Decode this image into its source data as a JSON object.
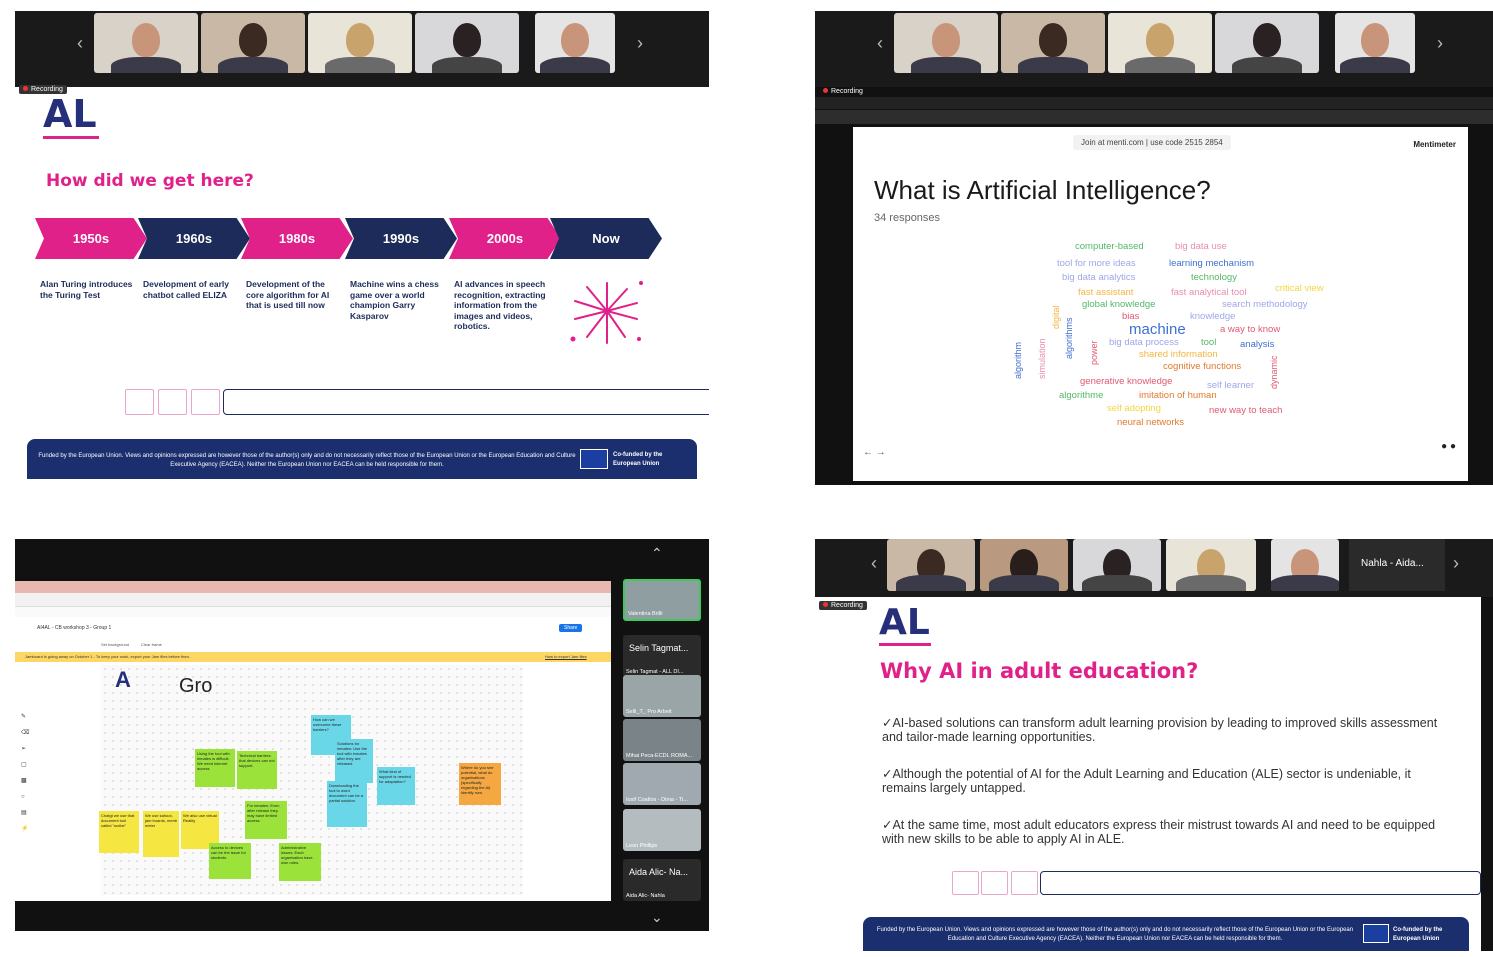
{
  "panel1": {
    "recording_label": "Recording",
    "logo_text": "AL",
    "title": "How did we get here?",
    "timeline": [
      {
        "label": "1950s",
        "color": "#e0218a",
        "desc": "Alan Turing introduces the Turing Test"
      },
      {
        "label": "1960s",
        "color": "#1c2b5a",
        "desc": "Development of early chatbot called ELIZA"
      },
      {
        "label": "1980s",
        "color": "#e0218a",
        "desc": "Development of the core algorithm for AI that is used till now"
      },
      {
        "label": "1990s",
        "color": "#1c2b5a",
        "desc": "Machine wins a chess game over a world champion Garry Kasparov"
      },
      {
        "label": "2000s",
        "color": "#e0218a",
        "desc": "AI advances in speech recognition, extracting information from the images and videos, robotics."
      },
      {
        "label": "Now",
        "color": "#1c2b5a",
        "desc": ""
      }
    ],
    "footer_text": "Funded by the European Union. Views and opinions expressed are however those of the author(s) only and do not necessarily reflect those of the European Union or the European Education and Culture Executive Agency (EACEA). Neither the European Union nor EACEA can be held responsible for them.",
    "cofunded": "Co-funded by the European Union"
  },
  "panel2": {
    "recording_label": "Recording",
    "join_text": "Join at menti.com | use code",
    "join_code": "2515 2854",
    "brand": "Mentimeter",
    "question": "What is Artificial Intelligence?",
    "responses": "34 responses",
    "words": [
      {
        "text": "computer-based",
        "color": "#52b86a"
      },
      {
        "text": "big data use",
        "color": "#e98fa8"
      },
      {
        "text": "tool for more ideas",
        "color": "#9fa6e8"
      },
      {
        "text": "learning mechanism",
        "color": "#3f6fd1"
      },
      {
        "text": "big data analytics",
        "color": "#9fa6e8"
      },
      {
        "text": "technology",
        "color": "#52b86a"
      },
      {
        "text": "fast assistant",
        "color": "#f2b642"
      },
      {
        "text": "fast analytical tool",
        "color": "#e98fa8"
      },
      {
        "text": "critical view",
        "color": "#f2d642"
      },
      {
        "text": "global knowledge",
        "color": "#52b86a"
      },
      {
        "text": "search methodology",
        "color": "#9fa6e8"
      },
      {
        "text": "bias",
        "color": "#e05a70"
      },
      {
        "text": "knowledge",
        "color": "#9fa6e8"
      },
      {
        "text": "machine",
        "color": "#3f6fd1"
      },
      {
        "text": "a way to know",
        "color": "#e05a70"
      },
      {
        "text": "big data process",
        "color": "#9fa6e8"
      },
      {
        "text": "tool",
        "color": "#52b86a"
      },
      {
        "text": "analysis",
        "color": "#3f6fd1"
      },
      {
        "text": "shared information",
        "color": "#f2b642"
      },
      {
        "text": "cognitive functions",
        "color": "#e07a30"
      },
      {
        "text": "generative knowledge",
        "color": "#e05a70"
      },
      {
        "text": "self learner",
        "color": "#9fa6e8"
      },
      {
        "text": "algorithme",
        "color": "#52b86a"
      },
      {
        "text": "imitation of human",
        "color": "#e07a30"
      },
      {
        "text": "self adopting",
        "color": "#f2d642"
      },
      {
        "text": "new way to teach",
        "color": "#e05a70"
      },
      {
        "text": "neural networks",
        "color": "#e07a30"
      },
      {
        "text": "algorithm",
        "color": "#3f6fd1"
      },
      {
        "text": "simulation",
        "color": "#e98fa8"
      },
      {
        "text": "digital",
        "color": "#f2b642"
      },
      {
        "text": "algorithms",
        "color": "#3f6fd1"
      },
      {
        "text": "power",
        "color": "#e05a70"
      },
      {
        "text": "dynamic",
        "color": "#e05a70"
      }
    ]
  },
  "panel3": {
    "board_title": "AI4AL - CB workshop 3 - Group 1",
    "banner": "Jamboard is going away on October 1 - To keep your work, export your Jam files before then.",
    "banner_link": "How to export Jam files",
    "share_label": "Share",
    "set_background": "Set background",
    "clear_frame": "Clear frame",
    "frame_heading": "Gro",
    "participants": [
      {
        "name": "Valentina Brilli"
      },
      {
        "name": "Selin Tagmat...",
        "sub": "Selin Tagmat - ALL DI..."
      },
      {
        "name": "Selil_T_ Pro Arbeit"
      },
      {
        "name": "Mihai Peca-ECDL ROMA..."
      },
      {
        "name": "Iosif Coatlos - Dima - Ti..."
      },
      {
        "name": "Leon Phillips"
      },
      {
        "name": "Aida Alic- Na...",
        "sub": "Aida Alic- Nahla"
      }
    ],
    "stickies": [
      {
        "text": "Chatgt we use that document tool called \"scribe\"",
        "color": "#f5e642"
      },
      {
        "text": "We use kahoot, jam boards, menti meter",
        "color": "#f5e642"
      },
      {
        "text": "We also use virtual Reality",
        "color": "#f5e642"
      },
      {
        "text": "Technical barriers: that devices can not support.",
        "color": "#9be33a"
      },
      {
        "text": "Using the tool with inmates is difficult. We need internet access",
        "color": "#9be33a"
      },
      {
        "text": "How can we overcome these barriers?",
        "color": "#6ad7e8"
      },
      {
        "text": "Solutions for inmates: Use the tool with inmates after they are released",
        "color": "#6ad7e8"
      },
      {
        "text": "Downloading the tool to word document can be a partial solution.",
        "color": "#6ad7e8"
      },
      {
        "text": "What kind of support is needed for adaptation?",
        "color": "#6ad7e8"
      },
      {
        "text": "Where do you see potential, what do organisations (specifically regarding the Al) identify now",
        "color": "#f5a742"
      },
      {
        "text": "For inmates: Even after release they may have limited access.",
        "color": "#9be33a"
      },
      {
        "text": "Access to devices can be the issue for students.",
        "color": "#9be33a"
      },
      {
        "text": "Administrative issues: Each organisation have own rules.",
        "color": "#9be33a"
      }
    ]
  },
  "panel4": {
    "recording_label": "Recording",
    "logo_text": "AL",
    "top_name": "Nahla - Aida...",
    "title": "Why AI in adult education?",
    "bullets": [
      "✓AI-based solutions can transform adult learning provision by leading to improved skills assessment and tailor-made learning opportunities.",
      "✓Although the potential of AI for the Adult Learning and Education (ALE) sector is undeniable, it remains largely untapped.",
      "✓At the same time, most adult educators express their mistrust towards AI and need to be equipped with new skills to be able to apply AI in ALE."
    ],
    "footer_text": "Funded by the European Union. Views and opinions expressed are however those of the author(s) only and do not necessarily reflect those of the European Union or the European Education and Culture Executive Agency (EACEA). Neither the European Union nor EACEA can be held responsible for them.",
    "cofunded": "Co-funded by the European Union"
  }
}
